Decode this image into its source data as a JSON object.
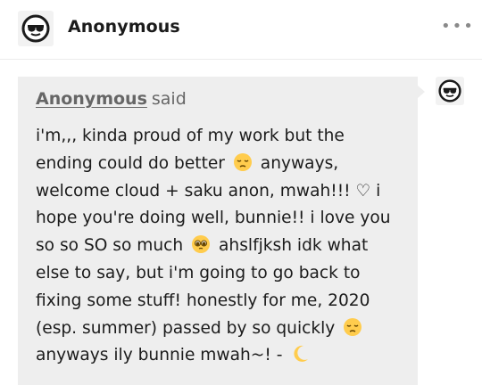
{
  "post": {
    "author": "Anonymous",
    "more_label": "•••",
    "icons": {
      "avatar": "anonymous-sunglasses-icon",
      "more": "more-options-icon",
      "answerer_avatar": "anonymous-sunglasses-icon"
    }
  },
  "ask": {
    "asker": "Anonymous",
    "said": "said",
    "segments": [
      "i'm,,, kinda proud of my work but the ending could do better",
      "anyways, welcome cloud + saku anon, mwah!!! ♡ i hope you're doing well, bunnie!! i love you so so SO so much",
      "ahslfjksh idk what else to say, but i'm going to go back to fixing some stuff! honestly for me, 2020 (esp. summer) passed by so quickly",
      "anyways ily bunnie mwah~! -"
    ],
    "emoji_names": [
      "pensive-face-icon",
      "pleading-face-icon",
      "pensive-face-icon",
      "crescent-moon-icon"
    ]
  },
  "colors": {
    "bubble": "#eeeeee",
    "text": "#1b1b1b",
    "muted": "#666666",
    "emoji_yellow": "#ffcc4d"
  }
}
